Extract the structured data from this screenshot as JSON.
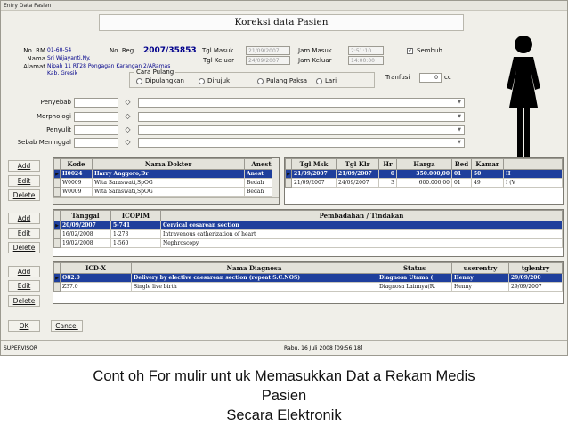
{
  "window": {
    "title": "Entry Data Pasien",
    "heading": "Koreksi data Pasien"
  },
  "patient": {
    "no_rm_label": "No. RM",
    "no_rm": "01-60-54",
    "nama_label": "Nama",
    "nama": "Sri Wijayanti,Ny.",
    "alamat_label": "Alamat",
    "alamat": "Nipah 11 RT28 Pongagan Karangan 2/ARamas",
    "alamat2": "Kab. Gresik",
    "no_reg_label": "No. Reg",
    "no_reg": "2007/35853",
    "tgl_masuk_label": "Tgl Masuk",
    "tgl_masuk": "21/09/2007",
    "jam_masuk_label": "Jam Masuk",
    "jam_masuk": "2:51:10",
    "tgl_keluar_label": "Tgl Keluar",
    "tgl_keluar": "24/09/2007",
    "jam_keluar_label": "Jam Keluar",
    "jam_keluar": "14:00:00",
    "sembuh_label": "Sembuh",
    "sembuh_checked": "√",
    "cara_pulang_label": "Cara Pulang",
    "radio_dipulangkan": "Dipulangkan",
    "radio_dirujuk": "Dirujuk",
    "radio_pulang_paksa": "Pulang Paksa",
    "radio_lari": "Lari",
    "tranfusi_label": "Tranfusi",
    "tranfusi_value": "0",
    "tranfusi_unit": "cc"
  },
  "fields": [
    {
      "label": "Penyebab"
    },
    {
      "label": "Morphologi"
    },
    {
      "label": "Penyulit"
    },
    {
      "label": "Sebab Meninggal"
    }
  ],
  "buttons": {
    "add": "Add",
    "edit": "Edit",
    "delete": "Delete",
    "ok": "OK",
    "cancel": "Cancel"
  },
  "dokter_grid": {
    "columns": [
      "Kode",
      "Nama Dokter",
      "Anest"
    ],
    "rows": [
      [
        "H0024",
        "Harry Anggoro,Dr",
        "Anest"
      ],
      [
        "W0009",
        "Wita Saraswati,SpOG",
        "Bedah"
      ],
      [
        "W0009",
        "Wita Saraswati,SpOG",
        "Bedah"
      ]
    ]
  },
  "kamar_grid": {
    "columns": [
      "Tgl Msk",
      "Tgl Klr",
      "Hr",
      "Harga",
      "Bed",
      "Kamar",
      ""
    ],
    "rows": [
      [
        "21/09/2007",
        "21/09/2007",
        "0",
        "350.000,00",
        "01",
        "50",
        "II"
      ],
      [
        "21/09/2007",
        "24/09/2007",
        "3",
        "600.000,00",
        "01",
        "49",
        "I (V"
      ]
    ]
  },
  "tindakan_grid": {
    "columns": [
      "Tanggal",
      "ICOPIM",
      "Pembadahan / Tindakan"
    ],
    "rows": [
      [
        "20/09/2007",
        "5-741",
        "Cervical cesarean section"
      ],
      [
        "16/02/2008",
        "1-273",
        "Intravenous catherization of heart"
      ],
      [
        "19/02/2008",
        "1-560",
        "Nephroscopy"
      ]
    ]
  },
  "diagnosa_grid": {
    "columns": [
      "ICD-X",
      "Nama Diagnosa",
      "Status",
      "userentry",
      "tglentry"
    ],
    "rows": [
      [
        "O82.0",
        "Delivery by elective caesarean section (repeat S.C.NOS)",
        "Diagnosa Utama (",
        "Henny",
        "29/09/200"
      ],
      [
        "Z37.0",
        "Single live birth",
        "Diagnosa Lainnya(R.",
        "Henny",
        "29/09/2007"
      ]
    ]
  },
  "status": {
    "user": "SUPERVISOR",
    "datetime": "Rabu, 16 Juli 2008 [09:56:18]"
  },
  "caption": {
    "line1": "Cont oh For mulir  unt uk Memasukkan Dat a Rekam Medis",
    "line2": "Pasien",
    "line3": "Secara Elektronik"
  },
  "colors": {
    "selection": "#1f3f9c",
    "value_text": "#00008b",
    "window_bg": "#f0efe9"
  },
  "icons": {
    "lookup": "eye-icon",
    "patient_gender": "female-figure-icon"
  }
}
